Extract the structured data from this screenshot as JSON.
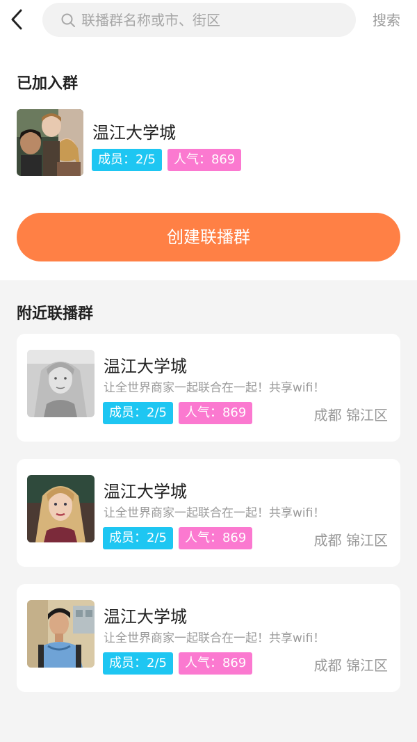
{
  "header": {
    "back_icon": "chevron-left-icon",
    "search_icon": "search-icon",
    "search_placeholder": "联播群名称或市、街区",
    "search_value": "",
    "search_button": "搜索"
  },
  "joined": {
    "title": "已加入群",
    "group": {
      "name": "温江大学城",
      "members": "成员：2/5",
      "popularity": "人气：869",
      "avatar": "group-photo-avatar"
    }
  },
  "create_button": "创建联播群",
  "nearby": {
    "title": "附近联播群",
    "groups": [
      {
        "name": "温江大学城",
        "desc": "让全世界商家一起联合在一起！共享wifi！",
        "members": "成员：2/5",
        "popularity": "人气：869",
        "location": "成都 锦江区",
        "avatar": "blonde-woman-bw-avatar"
      },
      {
        "name": "温江大学城",
        "desc": "让全世界商家一起联合在一起！共享wifi！",
        "members": "成员：2/5",
        "popularity": "人气：869",
        "location": "成都 锦江区",
        "avatar": "blonde-woman-avatar"
      },
      {
        "name": "温江大学城",
        "desc": "让全世界商家一起联合在一起！共享wifi！",
        "members": "成员：2/5",
        "popularity": "人气：869",
        "location": "成都 锦江区",
        "avatar": "young-man-avatar"
      }
    ]
  },
  "colors": {
    "accent_orange": "#ff8045",
    "member_badge": "#1ec6f2",
    "popularity_badge": "#fb79d0",
    "page_bg": "#f4f4f4"
  }
}
